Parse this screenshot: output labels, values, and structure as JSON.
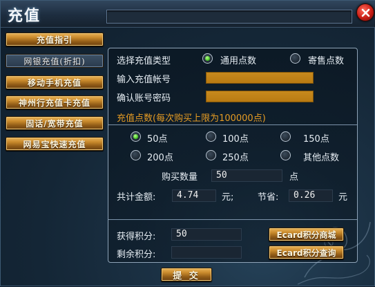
{
  "window": {
    "title": "充值",
    "close_icon": "close-icon",
    "accent": "#c98a2c",
    "highlight": "#e59b23"
  },
  "sidebar": {
    "items": [
      {
        "label": "充值指引",
        "active": false
      },
      {
        "label": "网银充值(折扣)",
        "active": true
      },
      {
        "label": "移动手机充值",
        "active": false
      },
      {
        "label": "神州行充值卡充值",
        "active": false
      },
      {
        "label": "固话/宽带充值",
        "active": false
      },
      {
        "label": "网易宝快速充值",
        "active": false
      }
    ]
  },
  "form": {
    "type_label": "选择充值类型",
    "type_options": [
      {
        "label": "通用点数",
        "selected": true
      },
      {
        "label": "寄售点数",
        "selected": false
      }
    ],
    "account_label": "输入充值帐号",
    "confirm_label": "确认账号密码",
    "points_header": "充值点数(每次购买上限为100000点)",
    "points_options": [
      {
        "label": "50点",
        "selected": true
      },
      {
        "label": "100点",
        "selected": false
      },
      {
        "label": "150点",
        "selected": false
      },
      {
        "label": "200点",
        "selected": false
      },
      {
        "label": "250点",
        "selected": false
      },
      {
        "label": "其他点数",
        "selected": false
      }
    ],
    "quantity_label": "购买数量",
    "quantity_value": "50",
    "quantity_unit": "点",
    "total_label": "共计金额:",
    "total_value": "4.74",
    "total_unit": "元;",
    "save_label": "节省:",
    "save_value": "0.26",
    "save_unit": "元"
  },
  "points": {
    "earned_label": "获得积分:",
    "earned_value": "50",
    "remaining_label": "剩余积分:",
    "remaining_value": "",
    "mall_button": "Ecard积分商城",
    "query_button": "Ecard积分查询"
  },
  "submit_label": "提 交"
}
